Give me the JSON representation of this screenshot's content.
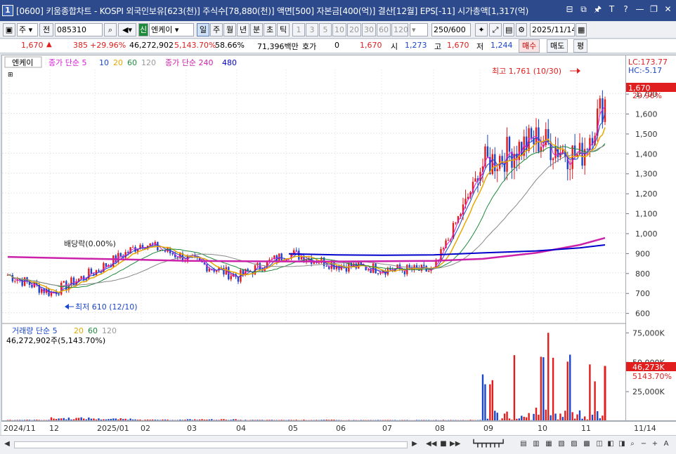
{
  "title": "[0600] 키움종합차트 - KOSPI 외국인보유[623(천)] 주식수[78,880(천)] 액면[500] 자본금[400(억)] 결산[12월] EPS[-11] 시가총액[1,317(억)",
  "window_icon": "1",
  "window_buttons": [
    "⊟",
    "⧉",
    "🖈",
    "T",
    "?",
    "—",
    "❐",
    "✕"
  ],
  "toolbar": {
    "market": "주",
    "prev_btn": "전",
    "code": "085310",
    "name_badge": "신",
    "stock_name": "엔케이",
    "periods": [
      "일",
      "주",
      "월",
      "년",
      "분",
      "초",
      "틱"
    ],
    "minutes": [
      "1",
      "3",
      "5",
      "10",
      "20",
      "30",
      "60",
      "120"
    ],
    "count": "250/600",
    "date": "2025/11/14"
  },
  "quote": {
    "price": "1,670",
    "change": "385",
    "change_pct": "+29.96%",
    "volume": "46,272,902",
    "volume_pct": "5,143.70%",
    "turnover": "58.66%",
    "amount": "71,396백만",
    "hoga_label": "호가",
    "hoga_value": "0",
    "hoga_price": "1,670",
    "open_label": "시",
    "open": "1,273",
    "high_label": "고",
    "high": "1,670",
    "low_label": "저",
    "low": "1,244",
    "buy_label": "매수",
    "sell_label": "매도",
    "eval_label": "평"
  },
  "legend": {
    "stock": "엔케이",
    "ma_label": "종가 단순 5",
    "ma10": "10",
    "ma20": "20",
    "ma60": "60",
    "ma120": "120",
    "ma_long": "종가 단순 240",
    "ma480": "480"
  },
  "annotations": {
    "high": "최고 1,761 (10/30)",
    "low": "최저 610 (12/10)",
    "dividend": "배당락(0.00%)"
  },
  "yaxis_top": {
    "lc": "LC:173.77",
    "hc": "HC:-5.17",
    "price": "1,670",
    "pct": "29.96%"
  },
  "vol_legend": {
    "label": "거래량 단순 5",
    "v20": "20",
    "v60": "60",
    "v120": "120",
    "value": "46,272,902주(5,143.70%)"
  },
  "vol_axis": {
    "value": "46,273K",
    "pct": "5143.70%"
  },
  "xaxis_labels": [
    "2024/11",
    "12",
    "2025/01",
    "02",
    "03",
    "04",
    "05",
    "06",
    "07",
    "08",
    "09",
    "10",
    "11",
    "11/14"
  ],
  "colors": {
    "up": "#e01e1e",
    "down": "#1c46c8",
    "ma5": "#d81bd8",
    "ma10": "#1c46c8",
    "ma20": "#e6a800",
    "ma60": "#1f8a3c",
    "ma120": "#888888",
    "ma240": "#cc22aa",
    "ma480": "#0000cc"
  },
  "chart_data": {
    "type": "line",
    "title": "",
    "y_ticks": [
      600,
      700,
      800,
      900,
      1000,
      1100,
      1200,
      1300,
      1400,
      1500,
      1600,
      1700
    ],
    "ylim": [
      560,
      1820
    ],
    "vol_ticks": [
      "25,000K",
      "50,000K",
      "75,000K"
    ],
    "vol_ylim": [
      0,
      80000
    ],
    "x": [
      "2024/11",
      "12",
      "2025/01",
      "02",
      "03",
      "04",
      "05",
      "06",
      "07",
      "08",
      "09",
      "10",
      "11",
      "11/14"
    ],
    "series": [
      {
        "name": "종가",
        "values": [
          790,
          700,
          810,
          950,
          870,
          780,
          900,
          840,
          820,
          810,
          1340,
          1470,
          1380,
          1670
        ]
      },
      {
        "name": "240",
        "values": [
          880,
          875,
          870,
          865,
          860,
          858,
          857,
          857,
          858,
          860,
          870,
          900,
          940,
          975
        ]
      },
      {
        "name": "480",
        "values": [
          null,
          null,
          null,
          null,
          null,
          null,
          895,
          890,
          888,
          890,
          900,
          910,
          925,
          940
        ]
      }
    ],
    "volume": [
      500,
      2200,
      1500,
      600,
      900,
      400,
      500,
      300,
      300,
      400,
      58000,
      75000,
      57000,
      46273
    ]
  }
}
